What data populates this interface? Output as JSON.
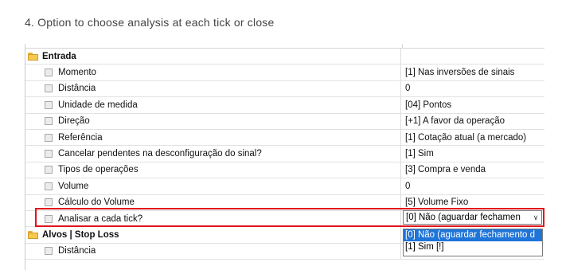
{
  "caption": "4. Option to choose analysis at each tick or close",
  "categories": {
    "entrada": "Entrada",
    "alvos": "Alvos | Stop Loss"
  },
  "rows": [
    {
      "name": "Momento",
      "value": "[1] Nas inversões de sinais"
    },
    {
      "name": "Distância",
      "value": "0"
    },
    {
      "name": "Unidade de medida",
      "value": "[04] Pontos"
    },
    {
      "name": "Direção",
      "value": "[+1] A favor da operação"
    },
    {
      "name": "Referência",
      "value": "[1] Cotação atual (a mercado)"
    },
    {
      "name": "Cancelar pendentes na desconfiguração do sinal?",
      "value": "[1] Sim"
    },
    {
      "name": "Tipos de operações",
      "value": "[3] Compra e venda"
    },
    {
      "name": "Volume",
      "value": "0"
    },
    {
      "name": "Cálculo do Volume",
      "value": "[5] Volume Fixo"
    },
    {
      "name": "Analisar a cada tick?",
      "value": ""
    }
  ],
  "alvos_rows": [
    {
      "name": "Distância",
      "value": ""
    }
  ],
  "combo": {
    "value": "[0] Não (aguardar fechamen"
  },
  "dropdown": {
    "options": [
      "[0] Não (aguardar fechamento d",
      "[1] Sim [!]"
    ]
  },
  "colors": {
    "highlight_border": "#e0141a",
    "selection": "#1e74d8",
    "folder": "#f6c850"
  },
  "icons": {
    "category": "folder-open-icon",
    "item": "checkbox-icon",
    "combo": "chevron-down-icon"
  }
}
